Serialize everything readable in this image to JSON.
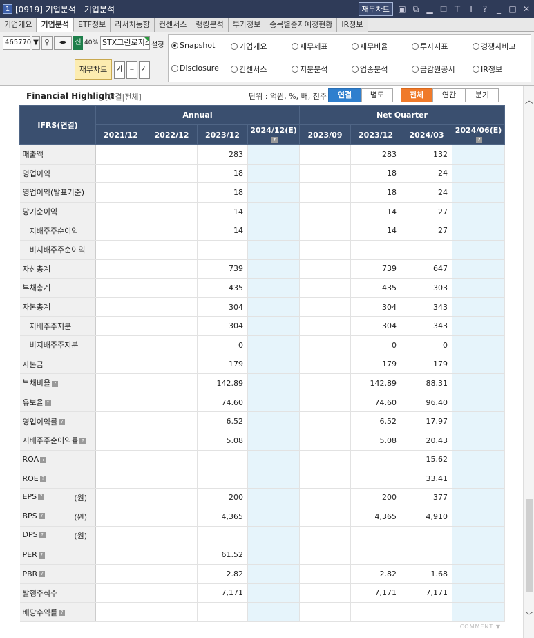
{
  "window": {
    "num": "1",
    "title": "[0919] 기업분석 - 기업분석",
    "fin_chart": "재무차트"
  },
  "tabs": [
    "기업개요",
    "기업분석",
    "ETF정보",
    "리서치동향",
    "컨센서스",
    "랭킹분석",
    "부가정보",
    "종목별증자예정현황",
    "IR정보"
  ],
  "toolbar": {
    "code": "465770",
    "badge": "신",
    "pct": "40%",
    "name": "STX그린로지스",
    "setting": "설정",
    "fin_chart": "재무차트"
  },
  "radios": [
    {
      "label": "Snapshot",
      "on": true
    },
    {
      "label": "기업개요",
      "on": false
    },
    {
      "label": "재무제표",
      "on": false
    },
    {
      "label": "재무비율",
      "on": false
    },
    {
      "label": "투자지표",
      "on": false
    },
    {
      "label": "경쟁사비교",
      "on": false
    },
    {
      "label": "Disclosure",
      "on": false
    },
    {
      "label": "컨센서스",
      "on": false
    },
    {
      "label": "지분분석",
      "on": false
    },
    {
      "label": "업종분석",
      "on": false
    },
    {
      "label": "금감원공시",
      "on": false
    },
    {
      "label": "IR정보",
      "on": false
    }
  ],
  "highlight": {
    "title": "Financial Highlight",
    "sub": "[연결|전체]",
    "unit": "단위 : 억원, %, 배, 천주",
    "seg1": [
      "연결",
      "별도"
    ],
    "seg2": [
      "전체",
      "연간",
      "분기"
    ]
  },
  "table": {
    "corner": "IFRS(연결)",
    "annual": "Annual",
    "quarter": "Net Quarter",
    "cols": [
      "2021/12",
      "2022/12",
      "2023/12",
      "2024/12(E)",
      "2023/09",
      "2023/12",
      "2024/03",
      "2024/06(E)"
    ],
    "rows": [
      {
        "label": "매출액",
        "q": false,
        "unit": "",
        "ind": false,
        "v": [
          "",
          "",
          "283",
          "",
          "",
          "283",
          "132",
          ""
        ]
      },
      {
        "label": "영업이익",
        "q": false,
        "unit": "",
        "ind": false,
        "v": [
          "",
          "",
          "18",
          "",
          "",
          "18",
          "24",
          ""
        ]
      },
      {
        "label": "영업이익(발표기준)",
        "q": false,
        "unit": "",
        "ind": false,
        "v": [
          "",
          "",
          "18",
          "",
          "",
          "18",
          "24",
          ""
        ]
      },
      {
        "label": "당기순이익",
        "q": false,
        "unit": "",
        "ind": false,
        "v": [
          "",
          "",
          "14",
          "",
          "",
          "14",
          "27",
          ""
        ]
      },
      {
        "label": "지배주주순이익",
        "q": false,
        "unit": "",
        "ind": true,
        "v": [
          "",
          "",
          "14",
          "",
          "",
          "14",
          "27",
          ""
        ]
      },
      {
        "label": "비지배주주순이익",
        "q": false,
        "unit": "",
        "ind": true,
        "v": [
          "",
          "",
          "",
          "",
          "",
          "",
          "",
          ""
        ]
      },
      {
        "label": "자산총계",
        "q": false,
        "unit": "",
        "ind": false,
        "v": [
          "",
          "",
          "739",
          "",
          "",
          "739",
          "647",
          ""
        ]
      },
      {
        "label": "부채총계",
        "q": false,
        "unit": "",
        "ind": false,
        "v": [
          "",
          "",
          "435",
          "",
          "",
          "435",
          "303",
          ""
        ]
      },
      {
        "label": "자본총계",
        "q": false,
        "unit": "",
        "ind": false,
        "v": [
          "",
          "",
          "304",
          "",
          "",
          "304",
          "343",
          ""
        ]
      },
      {
        "label": "지배주주지분",
        "q": false,
        "unit": "",
        "ind": true,
        "v": [
          "",
          "",
          "304",
          "",
          "",
          "304",
          "343",
          ""
        ]
      },
      {
        "label": "비지배주주지분",
        "q": false,
        "unit": "",
        "ind": true,
        "v": [
          "",
          "",
          "0",
          "",
          "",
          "0",
          "0",
          ""
        ]
      },
      {
        "label": "자본금",
        "q": false,
        "unit": "",
        "ind": false,
        "v": [
          "",
          "",
          "179",
          "",
          "",
          "179",
          "179",
          ""
        ]
      },
      {
        "label": "부채비율",
        "q": true,
        "unit": "",
        "ind": false,
        "v": [
          "",
          "",
          "142.89",
          "",
          "",
          "142.89",
          "88.31",
          ""
        ]
      },
      {
        "label": "유보율",
        "q": true,
        "unit": "",
        "ind": false,
        "v": [
          "",
          "",
          "74.60",
          "",
          "",
          "74.60",
          "96.40",
          ""
        ]
      },
      {
        "label": "영업이익률",
        "q": true,
        "unit": "",
        "ind": false,
        "v": [
          "",
          "",
          "6.52",
          "",
          "",
          "6.52",
          "17.97",
          ""
        ]
      },
      {
        "label": "지배주주순이익률",
        "q": true,
        "unit": "",
        "ind": false,
        "v": [
          "",
          "",
          "5.08",
          "",
          "",
          "5.08",
          "20.43",
          ""
        ]
      },
      {
        "label": "ROA",
        "q": true,
        "unit": "",
        "ind": false,
        "v": [
          "",
          "",
          "",
          "",
          "",
          "",
          "15.62",
          ""
        ]
      },
      {
        "label": "ROE",
        "q": true,
        "unit": "",
        "ind": false,
        "v": [
          "",
          "",
          "",
          "",
          "",
          "",
          "33.41",
          ""
        ]
      },
      {
        "label": "EPS",
        "q": true,
        "unit": "(원)",
        "ind": false,
        "v": [
          "",
          "",
          "200",
          "",
          "",
          "200",
          "377",
          ""
        ]
      },
      {
        "label": "BPS",
        "q": true,
        "unit": "(원)",
        "ind": false,
        "v": [
          "",
          "",
          "4,365",
          "",
          "",
          "4,365",
          "4,910",
          ""
        ]
      },
      {
        "label": "DPS",
        "q": true,
        "unit": "(원)",
        "ind": false,
        "v": [
          "",
          "",
          "",
          "",
          "",
          "",
          "",
          ""
        ]
      },
      {
        "label": "PER",
        "q": true,
        "unit": "",
        "ind": false,
        "v": [
          "",
          "",
          "61.52",
          "",
          "",
          "",
          "",
          ""
        ]
      },
      {
        "label": "PBR",
        "q": true,
        "unit": "",
        "ind": false,
        "v": [
          "",
          "",
          "2.82",
          "",
          "",
          "2.82",
          "1.68",
          ""
        ]
      },
      {
        "label": "발행주식수",
        "q": false,
        "unit": "",
        "ind": false,
        "v": [
          "",
          "",
          "7,171",
          "",
          "",
          "7,171",
          "7,171",
          ""
        ]
      },
      {
        "label": "배당수익률",
        "q": true,
        "unit": "",
        "ind": false,
        "v": [
          "",
          "",
          "",
          "",
          "",
          "",
          "",
          ""
        ]
      }
    ]
  },
  "footer": {
    "comment": "COMMENT ▼"
  }
}
